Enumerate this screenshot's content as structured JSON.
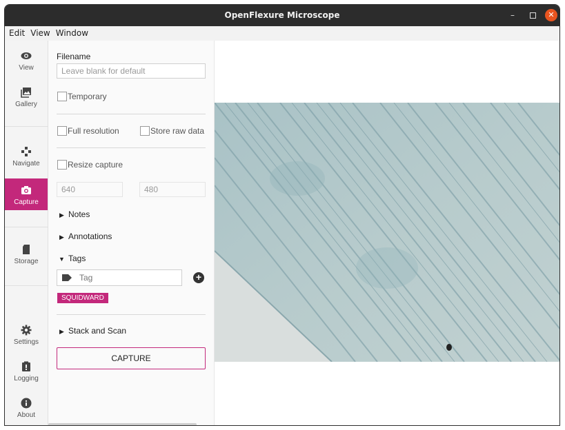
{
  "window": {
    "title": "OpenFlexure Microscope",
    "minimize_glyph": "–",
    "close_glyph": "✕"
  },
  "menubar": {
    "items": [
      "Edit",
      "View",
      "Window"
    ]
  },
  "sidebar": {
    "items": [
      {
        "label": "View",
        "icon": "eye-icon"
      },
      {
        "label": "Gallery",
        "icon": "gallery-icon"
      },
      {
        "label": "Navigate",
        "icon": "gamepad-icon"
      },
      {
        "label": "Capture",
        "icon": "camera-icon",
        "active": true
      },
      {
        "label": "Storage",
        "icon": "sd-card-icon"
      },
      {
        "label": "Settings",
        "icon": "gear-icon"
      },
      {
        "label": "Logging",
        "icon": "clipboard-alert-icon"
      },
      {
        "label": "About",
        "icon": "info-icon"
      }
    ],
    "accent_color": "#c3287b"
  },
  "capture": {
    "filename_label": "Filename",
    "filename_placeholder": "Leave blank for default",
    "temporary_label": "Temporary",
    "full_resolution_label": "Full resolution",
    "store_raw_label": "Store raw data",
    "resize_label": "Resize capture",
    "width_placeholder": "640",
    "height_placeholder": "480",
    "notes_label": "Notes",
    "annotations_label": "Annotations",
    "tags_label": "Tags",
    "tag_placeholder": "Tag",
    "tags": [
      "SQUIDWARD"
    ],
    "stack_scan_label": "Stack and Scan",
    "capture_button": "CAPTURE"
  }
}
